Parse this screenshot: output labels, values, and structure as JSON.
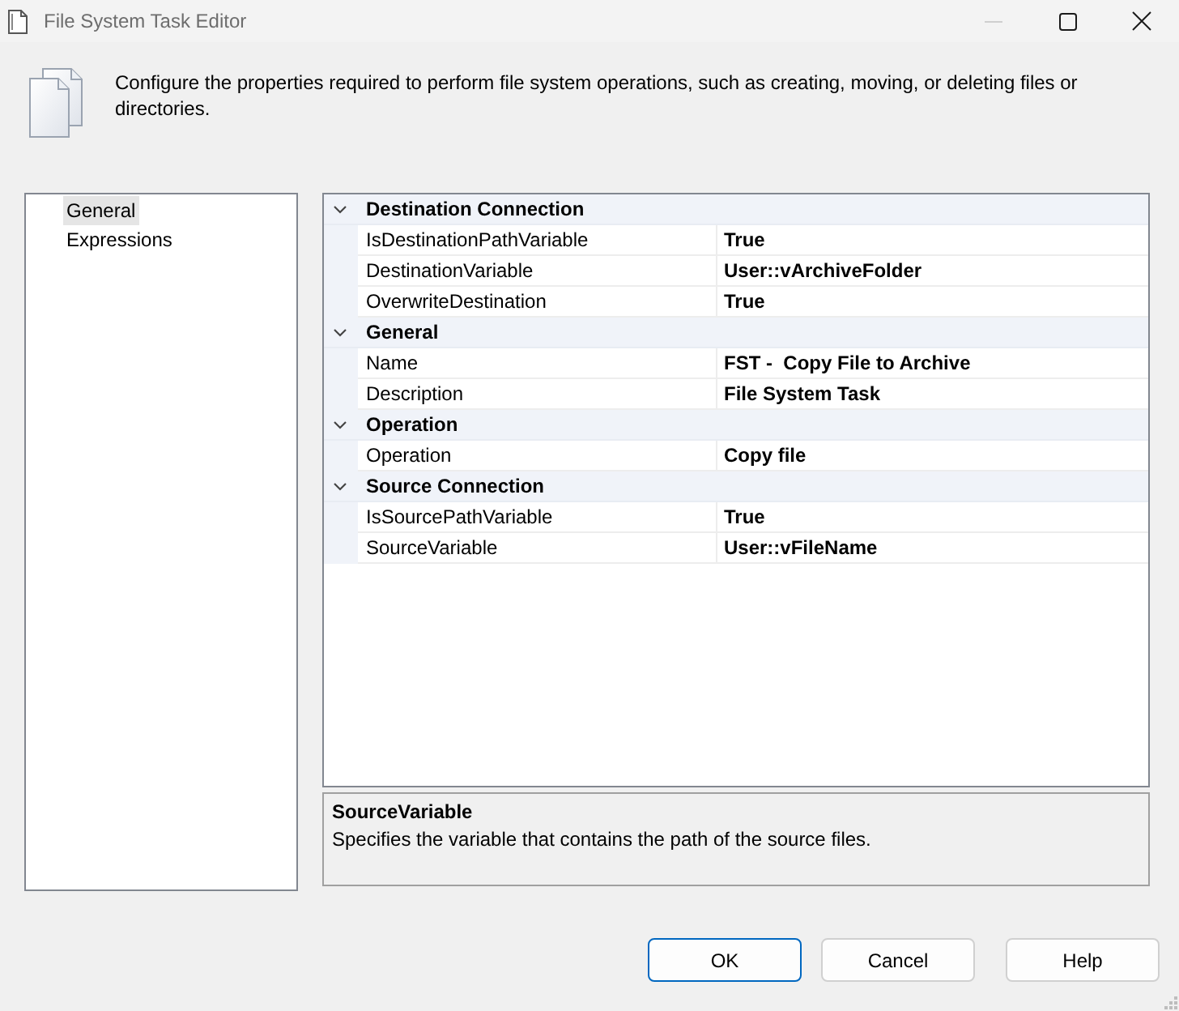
{
  "window": {
    "title": "File System Task Editor",
    "controls": [
      {
        "kind": "minimize",
        "disabled": true
      },
      {
        "kind": "maximize",
        "disabled": false
      },
      {
        "kind": "close",
        "disabled": false
      }
    ]
  },
  "header": {
    "text": "Configure the properties required to perform file system operations, such as creating, moving, or deleting files or directories."
  },
  "nav": {
    "items": [
      {
        "label": "General",
        "selected": true
      },
      {
        "label": "Expressions",
        "selected": false
      }
    ]
  },
  "property_grid": {
    "categories": [
      {
        "name": "Destination Connection",
        "expanded": true,
        "properties": [
          {
            "name": "IsDestinationPathVariable",
            "value": "True"
          },
          {
            "name": "DestinationVariable",
            "value": "User::vArchiveFolder"
          },
          {
            "name": "OverwriteDestination",
            "value": "True"
          }
        ]
      },
      {
        "name": "General",
        "expanded": true,
        "properties": [
          {
            "name": "Name",
            "value": "FST -  Copy File to Archive"
          },
          {
            "name": "Description",
            "value": "File System Task"
          }
        ]
      },
      {
        "name": "Operation",
        "expanded": true,
        "properties": [
          {
            "name": "Operation",
            "value": "Copy file"
          }
        ]
      },
      {
        "name": "Source Connection",
        "expanded": true,
        "properties": [
          {
            "name": "IsSourcePathVariable",
            "value": "True"
          },
          {
            "name": "SourceVariable",
            "value": "User::vFileName"
          }
        ]
      }
    ]
  },
  "description": {
    "title": "SourceVariable",
    "text": "Specifies the variable that contains the path of the source files."
  },
  "buttons": [
    {
      "label": "OK",
      "default": true
    },
    {
      "label": "Cancel",
      "default": false
    },
    {
      "label": "Help",
      "default": false
    }
  ]
}
